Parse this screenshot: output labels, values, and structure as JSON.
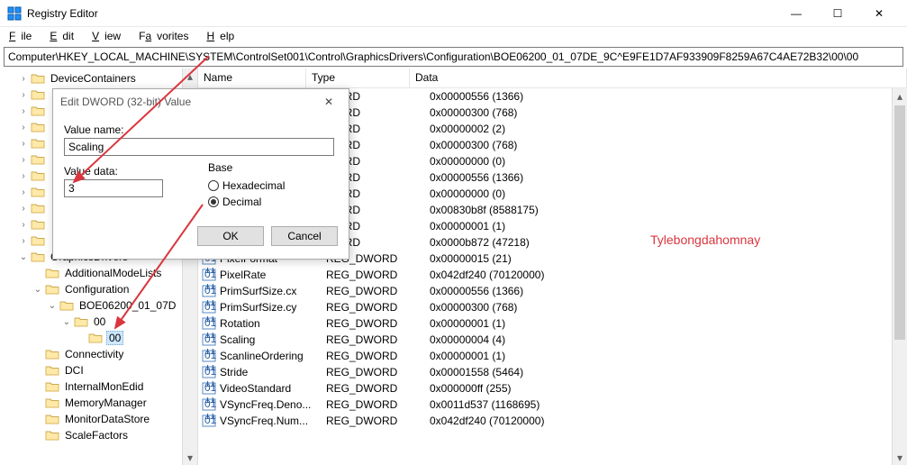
{
  "window": {
    "title": "Registry Editor",
    "controls": {
      "min": "—",
      "max": "☐",
      "close": "✕"
    }
  },
  "menu": {
    "file": "File",
    "edit": "Edit",
    "view": "View",
    "favorites": "Favorites",
    "help": "Help"
  },
  "address": "Computer\\HKEY_LOCAL_MACHINE\\SYSTEM\\ControlSet001\\Control\\GraphicsDrivers\\Configuration\\BOE06200_01_07DE_9C^E9FE1D7AF933909F8259A67C4AE72B32\\00\\00",
  "columns": {
    "name": "Name",
    "type": "Type",
    "data": "Data"
  },
  "tree": [
    {
      "depth": 1,
      "exp": "right",
      "label": "DeviceContainers",
      "sel": false
    },
    {
      "depth": 1,
      "exp": "right",
      "label": "",
      "sel": false,
      "hidden": true
    },
    {
      "depth": 1,
      "exp": "right",
      "label": "",
      "sel": false,
      "hidden": true
    },
    {
      "depth": 1,
      "exp": "right",
      "label": "",
      "sel": false,
      "hidden": true
    },
    {
      "depth": 1,
      "exp": "right",
      "label": "",
      "sel": false,
      "hidden": true
    },
    {
      "depth": 1,
      "exp": "right",
      "label": "",
      "sel": false,
      "hidden": true
    },
    {
      "depth": 1,
      "exp": "right",
      "label": "",
      "sel": false,
      "hidden": true
    },
    {
      "depth": 1,
      "exp": "right",
      "label": "",
      "sel": false,
      "hidden": true
    },
    {
      "depth": 1,
      "exp": "right",
      "label": "",
      "sel": false,
      "hidden": true
    },
    {
      "depth": 1,
      "exp": "right",
      "label": "",
      "sel": false,
      "hidden": true
    },
    {
      "depth": 1,
      "exp": "right",
      "label": "",
      "sel": false,
      "hidden": true
    },
    {
      "depth": 1,
      "exp": "down",
      "label": "GraphicsDrivers",
      "sel": false
    },
    {
      "depth": 2,
      "exp": "none",
      "label": "AdditionalModeLists",
      "sel": false
    },
    {
      "depth": 2,
      "exp": "down",
      "label": "Configuration",
      "sel": false
    },
    {
      "depth": 3,
      "exp": "down",
      "label": "BOE06200_01_07D",
      "sel": false
    },
    {
      "depth": 4,
      "exp": "down",
      "label": "00",
      "sel": false
    },
    {
      "depth": 5,
      "exp": "none",
      "label": "00",
      "sel": true
    },
    {
      "depth": 2,
      "exp": "none",
      "label": "Connectivity",
      "sel": false
    },
    {
      "depth": 2,
      "exp": "none",
      "label": "DCI",
      "sel": false
    },
    {
      "depth": 2,
      "exp": "none",
      "label": "InternalMonEdid",
      "sel": false
    },
    {
      "depth": 2,
      "exp": "none",
      "label": "MemoryManager",
      "sel": false
    },
    {
      "depth": 2,
      "exp": "none",
      "label": "MonitorDataStore",
      "sel": false
    },
    {
      "depth": 2,
      "exp": "none",
      "label": "ScaleFactors",
      "sel": false
    }
  ],
  "values": [
    {
      "name": "",
      "type": "WORD",
      "data": "0x00000556 (1366)"
    },
    {
      "name": "",
      "type": "WORD",
      "data": "0x00000300 (768)"
    },
    {
      "name": "",
      "type": "WORD",
      "data": "0x00000002 (2)"
    },
    {
      "name": "",
      "type": "WORD",
      "data": "0x00000300 (768)"
    },
    {
      "name": "",
      "type": "WORD",
      "data": "0x00000000 (0)"
    },
    {
      "name": "",
      "type": "WORD",
      "data": "0x00000556 (1366)"
    },
    {
      "name": "",
      "type": "WORD",
      "data": "0x00000000 (0)"
    },
    {
      "name": "",
      "type": "WORD",
      "data": "0x00830b8f (8588175)"
    },
    {
      "name": "",
      "type": "WORD",
      "data": "0x00000001 (1)"
    },
    {
      "name": "",
      "type": "WORD",
      "data": "0x0000b872 (47218)"
    },
    {
      "name": "PixelFormat",
      "type": "REG_DWORD",
      "data": "0x00000015 (21)"
    },
    {
      "name": "PixelRate",
      "type": "REG_DWORD",
      "data": "0x042df240 (70120000)"
    },
    {
      "name": "PrimSurfSize.cx",
      "type": "REG_DWORD",
      "data": "0x00000556 (1366)"
    },
    {
      "name": "PrimSurfSize.cy",
      "type": "REG_DWORD",
      "data": "0x00000300 (768)"
    },
    {
      "name": "Rotation",
      "type": "REG_DWORD",
      "data": "0x00000001 (1)"
    },
    {
      "name": "Scaling",
      "type": "REG_DWORD",
      "data": "0x00000004 (4)"
    },
    {
      "name": "ScanlineOrdering",
      "type": "REG_DWORD",
      "data": "0x00000001 (1)"
    },
    {
      "name": "Stride",
      "type": "REG_DWORD",
      "data": "0x00001558 (5464)"
    },
    {
      "name": "VideoStandard",
      "type": "REG_DWORD",
      "data": "0x000000ff (255)"
    },
    {
      "name": "VSyncFreq.Deno...",
      "type": "REG_DWORD",
      "data": "0x0011d537 (1168695)"
    },
    {
      "name": "VSyncFreq.Num...",
      "type": "REG_DWORD",
      "data": "0x042df240 (70120000)"
    }
  ],
  "dialog": {
    "title": "Edit DWORD (32-bit) Value",
    "value_name_label": "Value name:",
    "value_name": "Scaling",
    "value_data_label": "Value data:",
    "value_data": "3",
    "base_label": "Base",
    "hex_label": "Hexadecimal",
    "dec_label": "Decimal",
    "ok": "OK",
    "cancel": "Cancel",
    "base_selected": "decimal"
  },
  "annotation": "Tylebongdahomnay"
}
